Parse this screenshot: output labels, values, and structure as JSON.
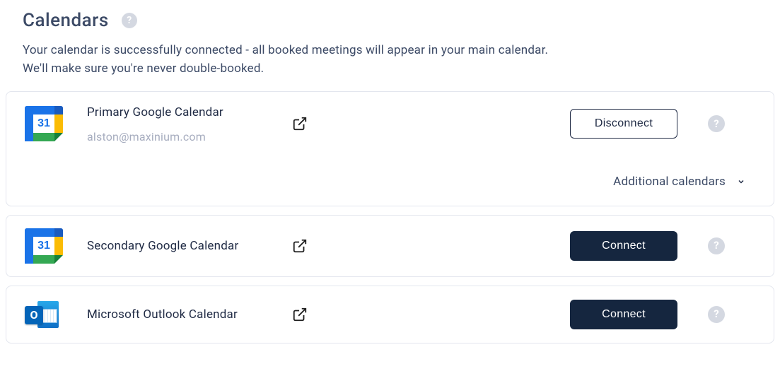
{
  "header": {
    "title": "Calendars",
    "help_glyph": "?"
  },
  "description_line1": "Your calendar is successfully connected - all booked meetings will appear in your main calendar.",
  "description_line2": "We'll make sure you're never double-booked.",
  "providers": {
    "primary": {
      "name": "Primary Google Calendar",
      "account": "alston@maxinium.com",
      "button_label": "Disconnect",
      "additional_label": "Additional calendars"
    },
    "secondary": {
      "name": "Secondary Google Calendar",
      "button_label": "Connect"
    },
    "outlook": {
      "name": "Microsoft Outlook Calendar",
      "button_label": "Connect"
    }
  },
  "icons": {
    "gcal_day": "31",
    "outlook_letter": "O"
  },
  "colors": {
    "brand_dark": "#15263f",
    "text_muted": "#a7adbf"
  }
}
